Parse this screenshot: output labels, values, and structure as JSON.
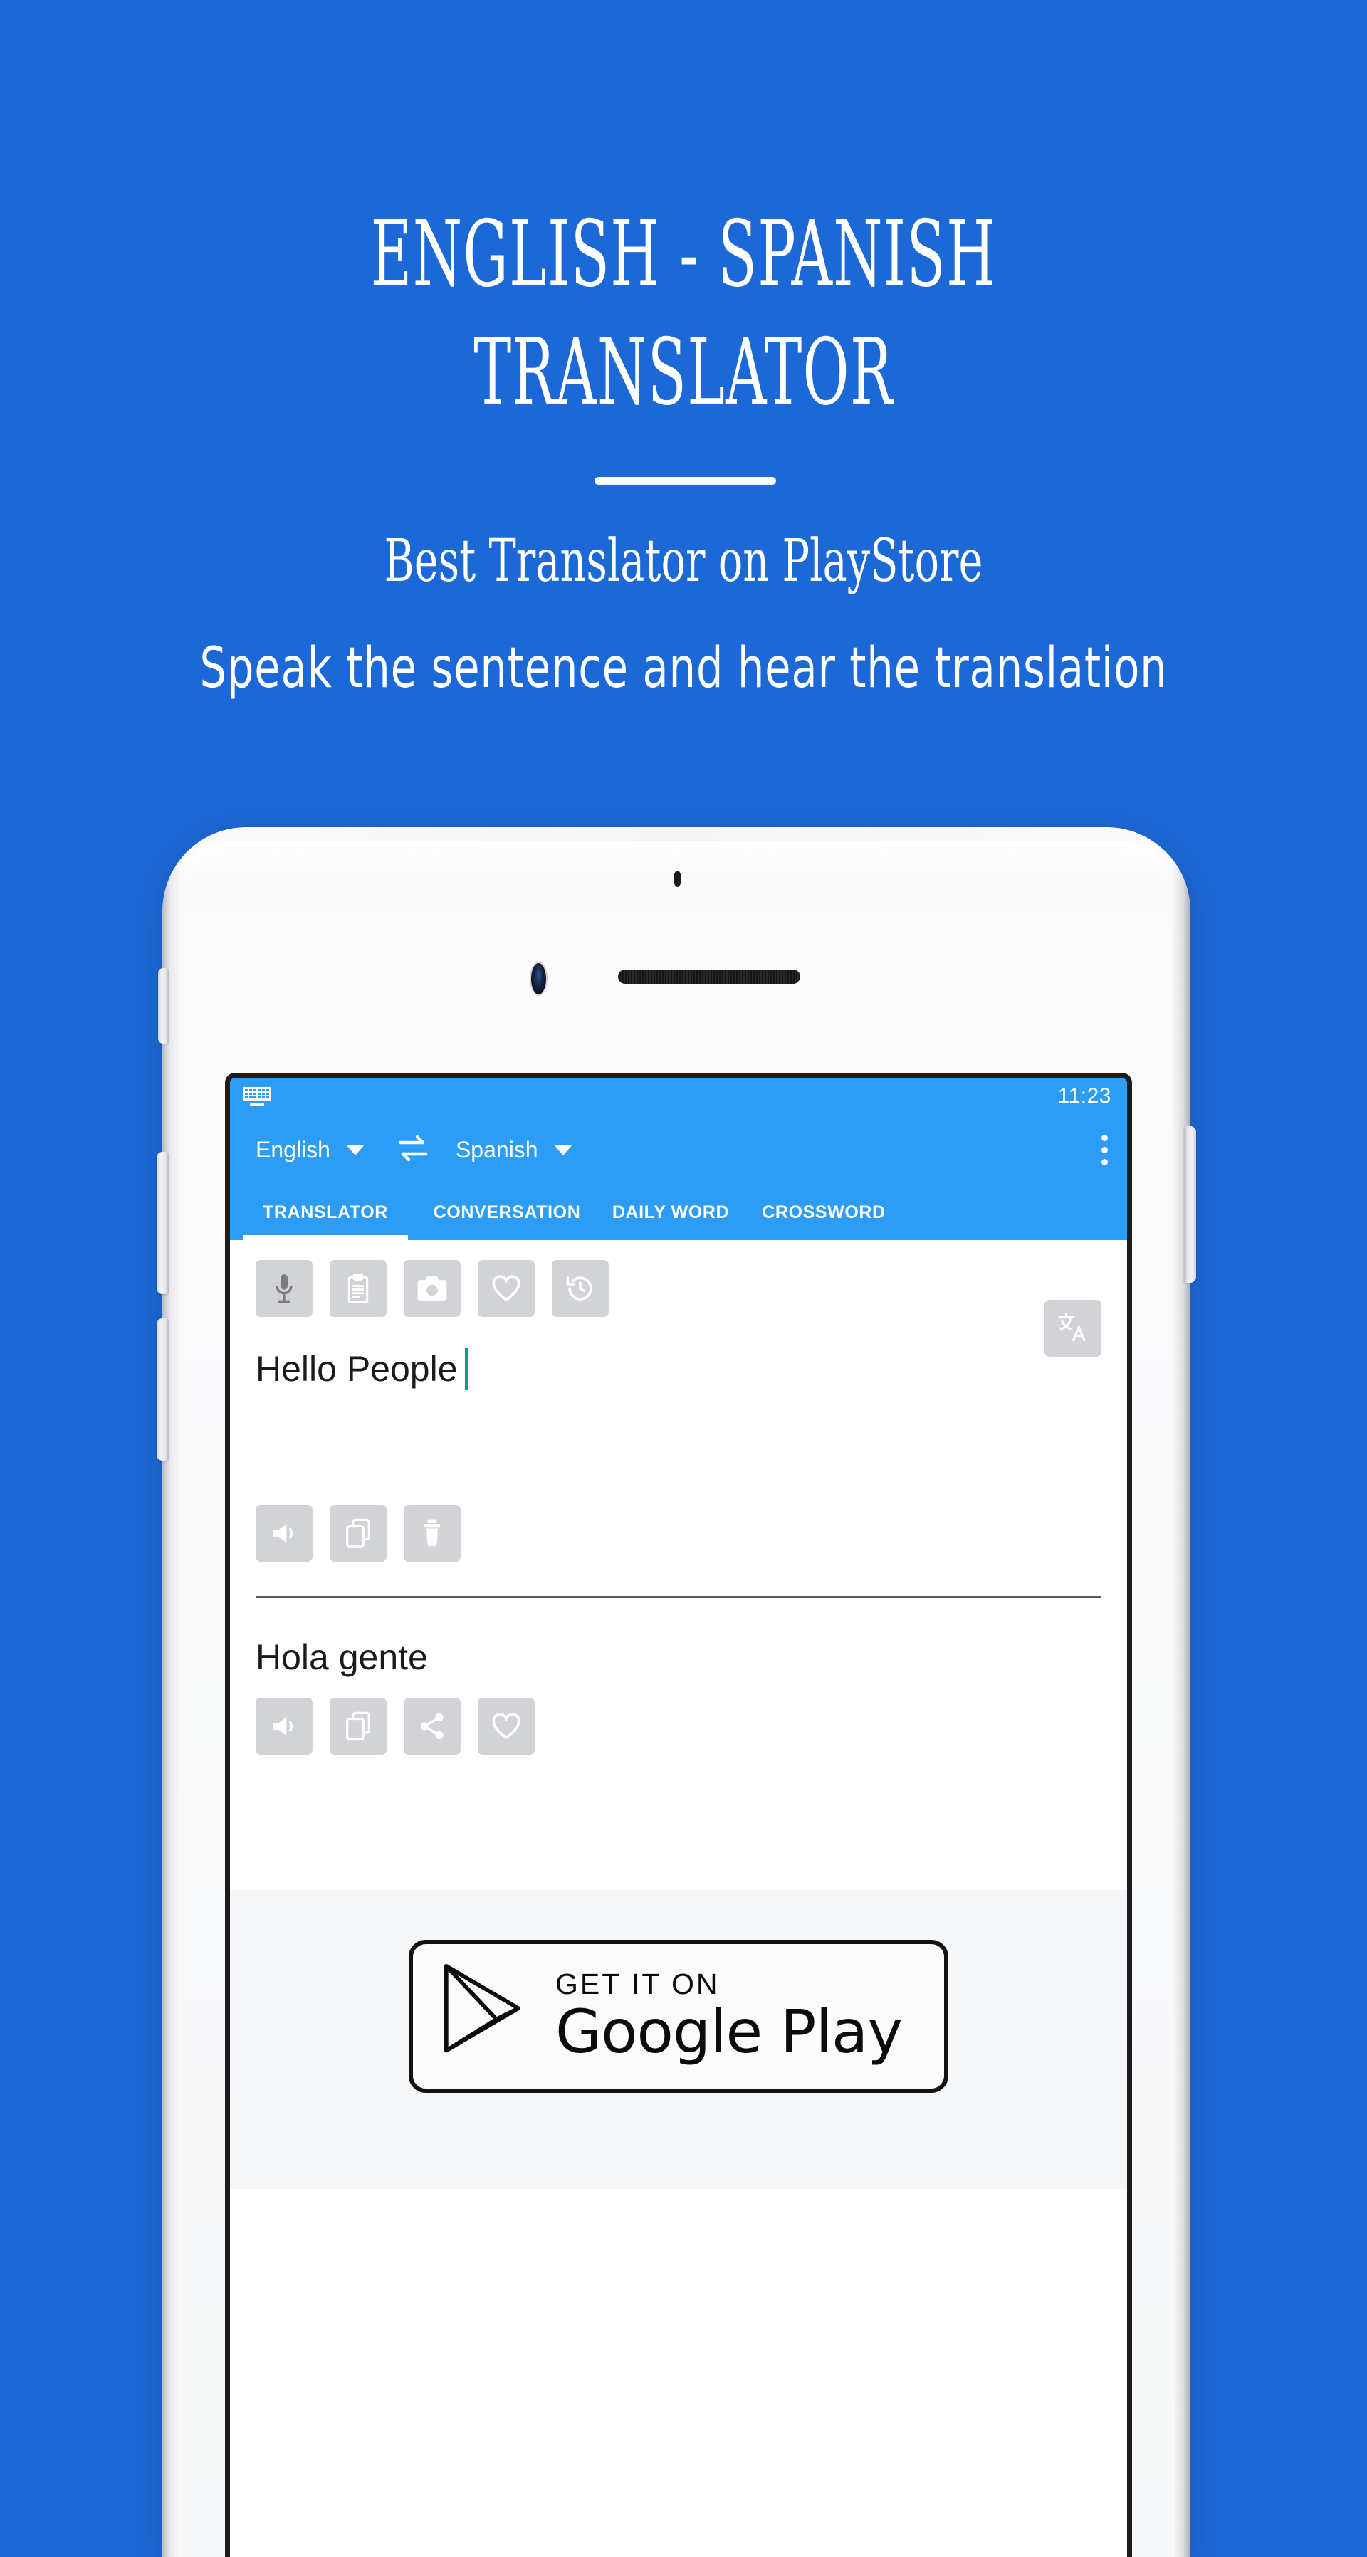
{
  "promo": {
    "headline": "ENGLISH - SPANISH\nTRANSLATOR",
    "subtitle_1": "Best Translator on PlayStore",
    "subtitle_2": "Speak the sentence and hear the translation",
    "background_color": "#1d68d7",
    "text_color": "#ffffff"
  },
  "app": {
    "accent_color": "#2d9cf5",
    "statusbar": {
      "keyboard_icon": "keyboard-icon",
      "time": "11:23"
    },
    "language_bar": {
      "source_language": "English",
      "target_language": "Spanish",
      "swap_icon": "swap-horizontal-icon",
      "overflow_icon": "more-vertical-icon",
      "source_caret_icon": "chevron-down-icon",
      "target_caret_icon": "chevron-down-icon"
    },
    "tabs": [
      {
        "label": "TRANSLATOR",
        "active": true
      },
      {
        "label": "CONVERSATION",
        "active": false
      },
      {
        "label": "DAILY WORD",
        "active": false
      },
      {
        "label": "CROSSWORD",
        "active": false
      }
    ],
    "toolbar_icons": [
      {
        "name": "microphone-icon",
        "label": "Voice input"
      },
      {
        "name": "clipboard-paste-icon",
        "label": "Paste"
      },
      {
        "name": "camera-icon",
        "label": "Camera"
      },
      {
        "name": "heart-icon",
        "label": "Favorites"
      },
      {
        "name": "history-icon",
        "label": "History"
      }
    ],
    "input": {
      "text": "Hello People",
      "cursor_color": "#0f9b8e",
      "translate_icon": "translate-icon"
    },
    "input_actions": [
      {
        "name": "speaker-icon",
        "label": "Listen"
      },
      {
        "name": "copy-icon",
        "label": "Copy"
      },
      {
        "name": "delete-icon",
        "label": "Delete"
      }
    ],
    "output": {
      "text": "Hola gente"
    },
    "output_actions": [
      {
        "name": "speaker-icon",
        "label": "Listen"
      },
      {
        "name": "copy-icon",
        "label": "Copy"
      },
      {
        "name": "share-icon",
        "label": "Share"
      },
      {
        "name": "heart-icon",
        "label": "Favorite"
      }
    ]
  },
  "play_badge": {
    "small_text": "GET IT ON",
    "large_text": "Google Play",
    "icon": "google-play-triangle-icon"
  }
}
